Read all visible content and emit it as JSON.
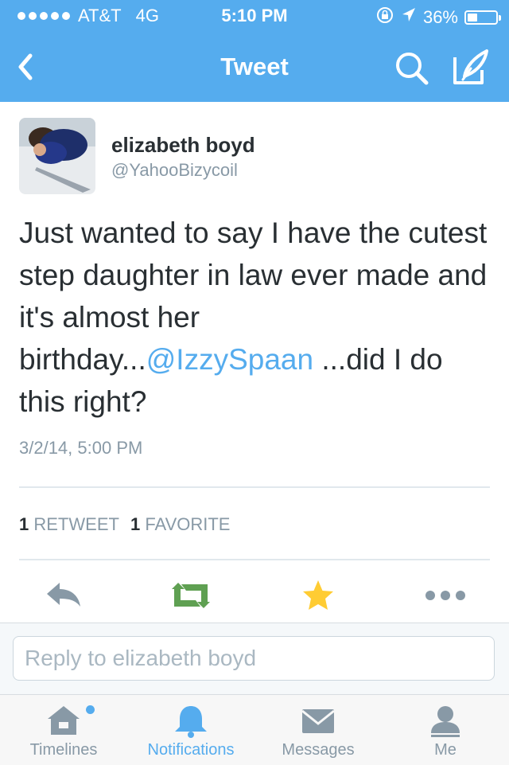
{
  "status_bar": {
    "carrier": "AT&T",
    "network": "4G",
    "time": "5:10 PM",
    "battery": "36%",
    "icons": [
      "orientation-lock-icon",
      "location-arrow-icon",
      "battery-icon"
    ]
  },
  "nav": {
    "title": "Tweet",
    "icons": [
      "back-icon",
      "search-icon",
      "compose-icon"
    ]
  },
  "tweet": {
    "name": "elizabeth boyd",
    "handle": "@YahooBizycoil",
    "text_before": "Just wanted to say I have the cutest step daughter in law ever made and it's almost her birthday...",
    "mention": "@IzzySpaan",
    "text_after": " ...did I do this right?",
    "timestamp": "3/2/14, 5:00 PM"
  },
  "stats": {
    "retweets_count": "1",
    "retweets_label": "RETWEET",
    "favorites_count": "1",
    "favorites_label": "FAVORITE"
  },
  "actions": [
    "reply-icon",
    "retweet-icon",
    "favorite-icon",
    "more-icon"
  ],
  "reply": {
    "placeholder": "Reply to elizabeth boyd"
  },
  "tabs": [
    {
      "label": "Timelines",
      "icon": "home-icon"
    },
    {
      "label": "Notifications",
      "icon": "bell-icon"
    },
    {
      "label": "Messages",
      "icon": "envelope-icon"
    },
    {
      "label": "Me",
      "icon": "person-icon"
    }
  ],
  "colors": {
    "brand": "#55acee",
    "retweet": "#5fa052",
    "favorite": "#ffcc33",
    "muted": "#8899a6",
    "text": "#292f33"
  }
}
